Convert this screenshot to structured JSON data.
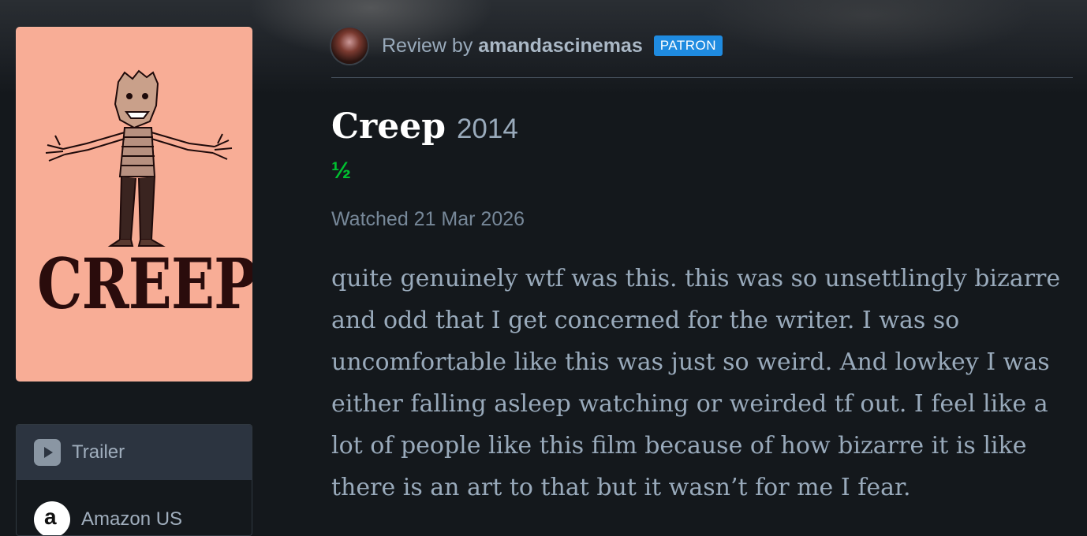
{
  "sidebar": {
    "poster_title": "CREEP",
    "services": [
      {
        "label": "Trailer",
        "icon": "play-icon"
      },
      {
        "label": "Amazon US",
        "icon": "amazon-icon",
        "icon_letter": "a"
      }
    ]
  },
  "review": {
    "prefix": "Review by",
    "username": "amandascinemas",
    "badge": "PATRON",
    "film_title": "Creep",
    "film_year": "2014",
    "rating": "½",
    "watched": "Watched 21 Mar 2026",
    "text": "quite genuinely wtf was this. this was so unsettlingly bizarre and odd that I get concerned for the writer. I was so uncomfortable like this was just so weird. And lowkey I was either falling asleep watching or weirded tf out. I feel like a lot of people like this film because of how bizarre it is like there is an art to that but it wasn’t for me I fear."
  },
  "colors": {
    "background": "#14181c",
    "poster_bg": "#f8ad96",
    "badge": "#1f8be0",
    "rating": "#00c030",
    "text": "#99aabb"
  }
}
